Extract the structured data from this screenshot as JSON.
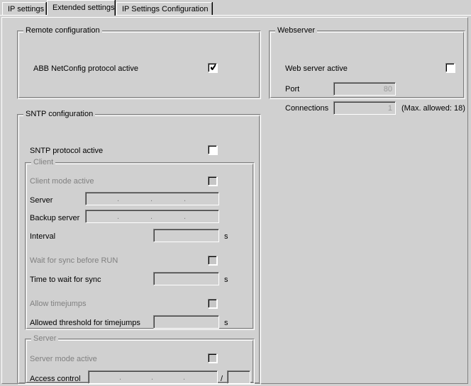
{
  "window": {
    "title": "IP Settings Configuration"
  },
  "tabs": [
    {
      "label": "IP settings",
      "selected": false
    },
    {
      "label": "Extended settings",
      "selected": true
    },
    {
      "label": "IP Settings Configuration",
      "selected": false
    }
  ],
  "remote_configuration": {
    "legend": "Remote configuration",
    "netconfig": {
      "label": "ABB NetConfig protocol active",
      "checked": true,
      "enabled": true
    }
  },
  "webserver": {
    "legend": "Webserver",
    "web_server_active": {
      "label": "Web server active",
      "checked": false,
      "enabled": true
    },
    "port": {
      "label": "Port",
      "value": "80",
      "enabled": false
    },
    "connections": {
      "label": "Connections",
      "value": "1",
      "enabled": false,
      "max_note": "(Max. allowed: 18)"
    }
  },
  "sntp_configuration": {
    "legend": "SNTP configuration",
    "sntp_protocol_active": {
      "label": "SNTP protocol active",
      "checked": false,
      "enabled": true
    },
    "client": {
      "legend": "Client",
      "enabled": false,
      "client_mode_active": {
        "label": "Client mode active",
        "checked": false,
        "enabled": false
      },
      "server": {
        "label": "Server",
        "value": "",
        "separator": ".",
        "enabled": false
      },
      "backup_server": {
        "label": "Backup server",
        "value": "",
        "separator": ".",
        "enabled": false
      },
      "interval": {
        "label": "Interval",
        "value": "",
        "unit": "s",
        "enabled": false
      },
      "wait_for_sync": {
        "label": "Wait for sync before RUN",
        "checked": false,
        "enabled": false
      },
      "time_to_wait": {
        "label": "Time to wait for sync",
        "value": "",
        "unit": "s",
        "enabled": false
      },
      "allow_timejumps": {
        "label": "Allow timejumps",
        "checked": false,
        "enabled": false
      },
      "allowed_threshold": {
        "label": "Allowed threshold for timejumps",
        "value": "",
        "unit": "s",
        "enabled": false
      }
    },
    "server": {
      "legend": "Server",
      "enabled": false,
      "server_mode_active": {
        "label": "Server mode active",
        "checked": false,
        "enabled": false
      },
      "access_control": {
        "label": "Access control",
        "value": "",
        "separator": ".",
        "slash": "/",
        "mask_value": "",
        "enabled": false
      }
    }
  },
  "colors": {
    "background": "#d0d0d0",
    "field_enabled_bg": "#ffffff",
    "field_disabled_bg": "#d0d0d0",
    "disabled_text": "#808080",
    "border_shadow": "#808080",
    "border_highlight": "#ffffff",
    "text": "#000000"
  }
}
